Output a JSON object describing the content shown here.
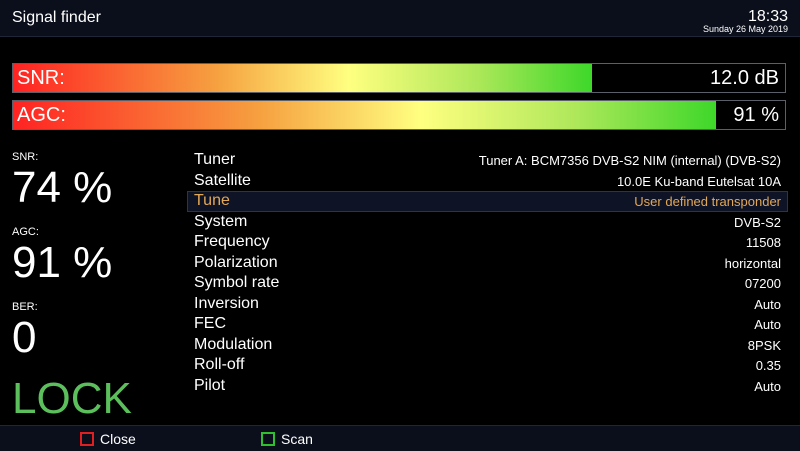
{
  "header": {
    "title": "Signal finder",
    "time": "18:33",
    "date": "Sunday 26 May 2019"
  },
  "bars": [
    {
      "label": "SNR:",
      "value": "12.0 dB",
      "fill_percent": 75
    },
    {
      "label": "AGC:",
      "value": "91 %",
      "fill_percent": 91
    }
  ],
  "stats": {
    "snr_label": "SNR:",
    "snr_value": "74 %",
    "agc_label": "AGC:",
    "agc_value": "91 %",
    "ber_label": "BER:",
    "ber_value": "0",
    "lock": "LOCK"
  },
  "details": [
    {
      "key": "Tuner",
      "value": "Tuner A: BCM7356 DVB-S2 NIM (internal) (DVB-S2)"
    },
    {
      "key": "Satellite",
      "value": "10.0E Ku-band Eutelsat 10A"
    },
    {
      "key": "Tune",
      "value": "User defined transponder",
      "selected": true
    },
    {
      "key": "System",
      "value": "DVB-S2"
    },
    {
      "key": "Frequency",
      "value": "11508"
    },
    {
      "key": "Polarization",
      "value": "horizontal"
    },
    {
      "key": "Symbol rate",
      "value": "07200"
    },
    {
      "key": "Inversion",
      "value": "Auto"
    },
    {
      "key": "FEC",
      "value": "Auto"
    },
    {
      "key": "Modulation",
      "value": "8PSK"
    },
    {
      "key": "Roll-off",
      "value": "0.35"
    },
    {
      "key": "Pilot",
      "value": "Auto"
    }
  ],
  "footer": {
    "close_label": "Close",
    "close_color": "#e02020",
    "scan_label": "Scan",
    "scan_color": "#2ec02e"
  },
  "colors": {
    "accent": "#e3a856",
    "lock": "#5bbf5b"
  }
}
